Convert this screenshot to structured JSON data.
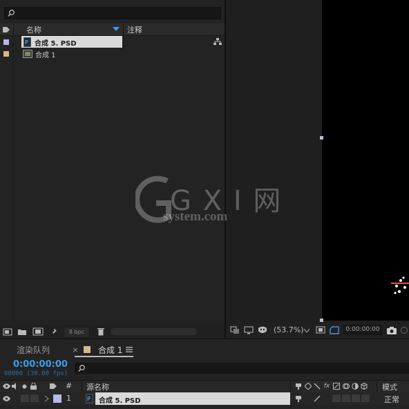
{
  "project": {
    "search": {
      "icon": "search-icon",
      "placeholder": ""
    },
    "columns": {
      "name": "名称",
      "comment": "注释"
    },
    "items": [
      {
        "name": "合成 5. PSD",
        "label_color": "#b6b8e8",
        "type": "psd-composition-icon",
        "selected": true
      },
      {
        "name": "合成 1",
        "label_color": "#d6b98b",
        "type": "composition-icon",
        "selected": false
      }
    ],
    "footer": {
      "bpc": "8 bpc"
    }
  },
  "viewer": {
    "zoom": "(53.7%)",
    "timecode": "0:00:00:00"
  },
  "timeline": {
    "tab_render_queue": "渲染队列",
    "tab_comp": "合成 1",
    "tab_comp_color": "#d6b98b",
    "timecode": "0:00:00:00",
    "frame_info": "00000 (30.00 fps)",
    "columns": {
      "hash": "#",
      "source_name": "源名称",
      "mode": "模式"
    },
    "layer": {
      "number": "1",
      "name": "合成 5. PSD",
      "label_color": "#b6b8e8",
      "mode": "正常"
    }
  },
  "watermark": {
    "logo": "G X I 网",
    "domain": "system.com"
  }
}
